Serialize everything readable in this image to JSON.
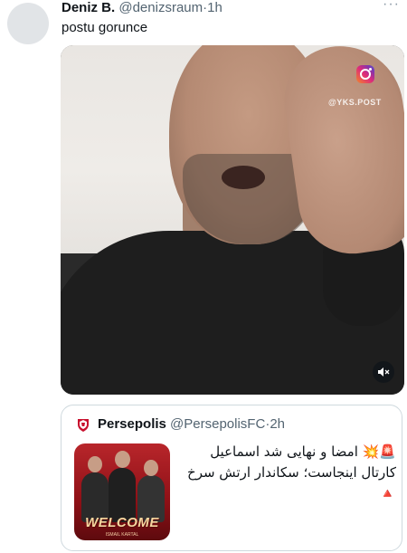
{
  "tweet": {
    "author_name": "Deniz B.",
    "handle": "@denizsraum",
    "separator": "·",
    "time": "1h",
    "more_icon": "···",
    "text": "postu gorunce"
  },
  "media": {
    "watermark": "@YKS.POST",
    "instagram_icon": "instagram-icon",
    "mute_icon": "speaker-muted-icon"
  },
  "quote": {
    "author_name": "Persepolis",
    "handle": "@PersepolisFC",
    "separator": "·",
    "time": "2h",
    "text": "🚨💥 امضا و نهایی شد اسماعیل کارتال اینجاست؛ سکاندار ارتش سرخ 🔺",
    "image_text": "WELCOME",
    "image_subtext": "ISMAIL KARTAL"
  },
  "colors": {
    "primary_text": "#0f1419",
    "secondary_text": "#536471",
    "border": "#cfd9de",
    "brand_red": "#b8262b"
  }
}
